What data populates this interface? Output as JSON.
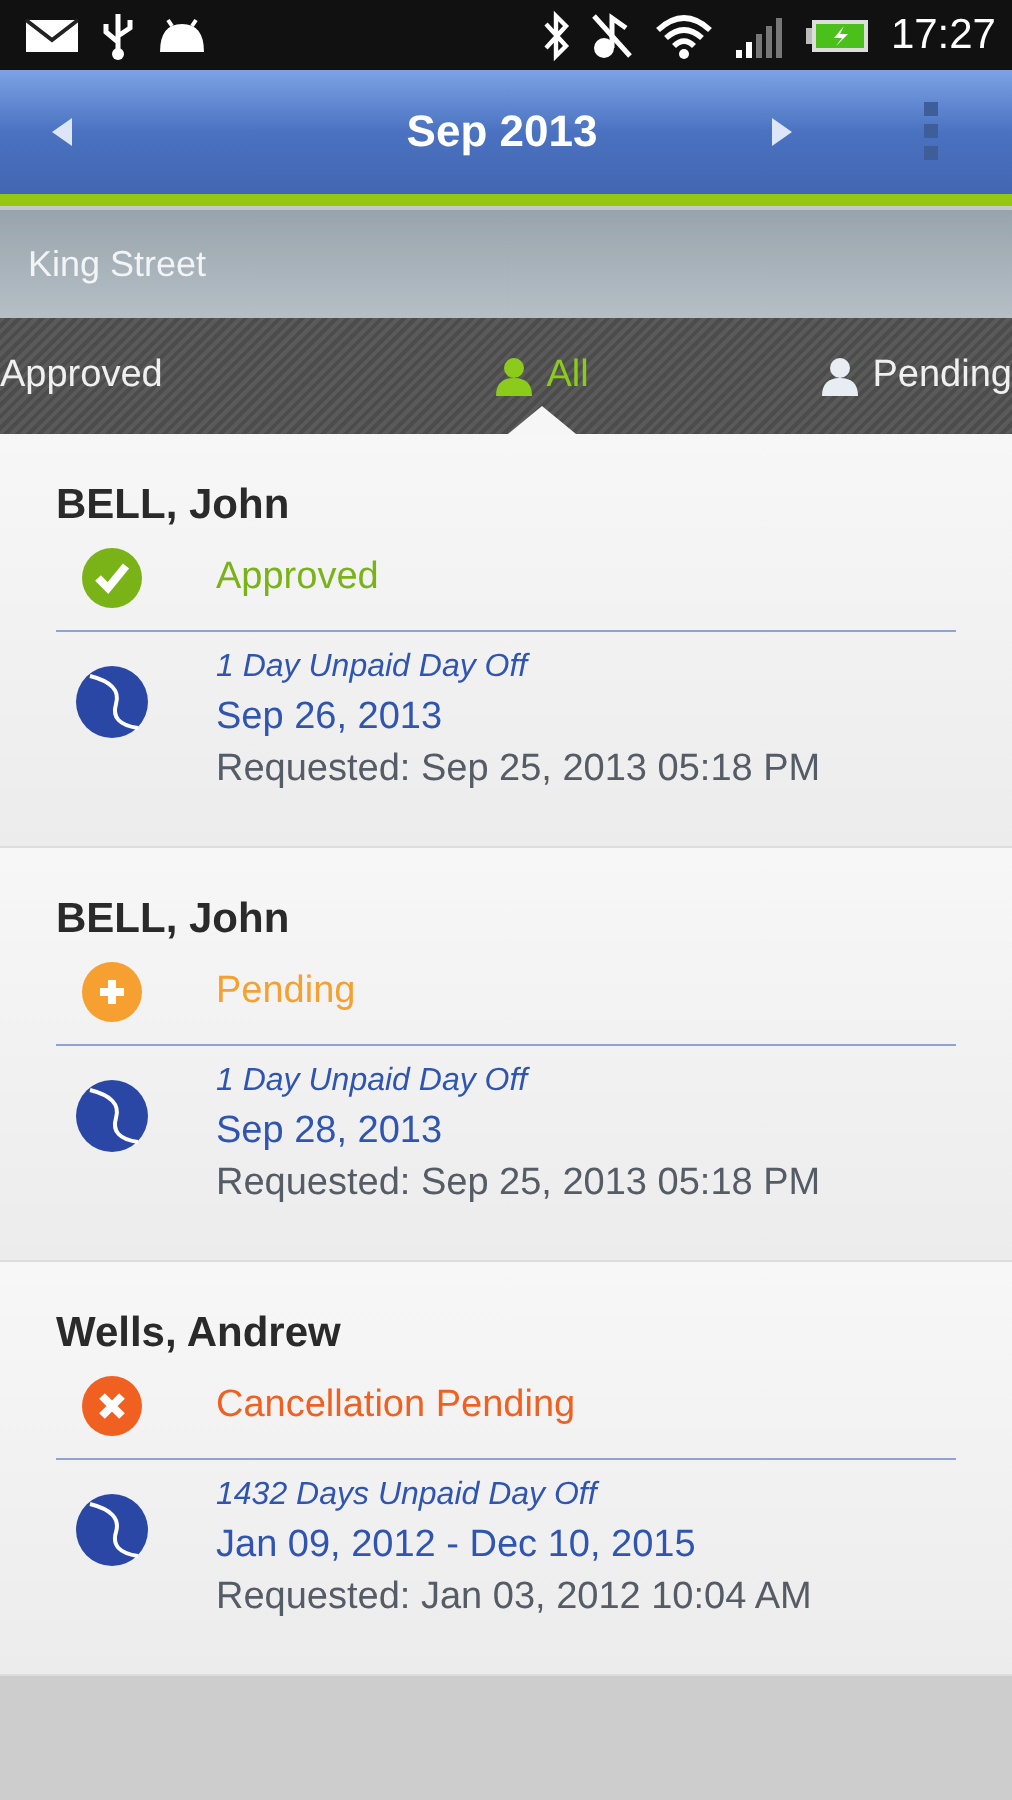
{
  "status_bar": {
    "time": "17:27"
  },
  "header": {
    "title": "Sep 2013"
  },
  "location": "King Street",
  "tabs": [
    {
      "label": "Approved",
      "selected": false,
      "icon": false
    },
    {
      "label": "All",
      "selected": true,
      "icon": true
    },
    {
      "label": "Pending",
      "selected": false,
      "icon": true
    }
  ],
  "requests": [
    {
      "name": "BELL, John",
      "status": "Approved",
      "kind": "approved",
      "color": "#7ab317",
      "type": "1 Day Unpaid Day Off",
      "dates": "Sep 26, 2013",
      "requested": "Requested: Sep 25, 2013 05:18 PM"
    },
    {
      "name": "BELL, John",
      "status": "Pending",
      "kind": "pending",
      "color": "#f5a030",
      "type": "1 Day Unpaid Day Off",
      "dates": "Sep 28, 2013",
      "requested": "Requested: Sep 25, 2013 05:18 PM"
    },
    {
      "name": "Wells, Andrew",
      "status": "Cancellation Pending",
      "kind": "cancellation",
      "color": "#f06020",
      "type": "1432 Days Unpaid Day Off",
      "dates": "Jan 09, 2012 - Dec 10, 2015",
      "requested": "Requested: Jan 03, 2012 10:04 AM"
    }
  ]
}
